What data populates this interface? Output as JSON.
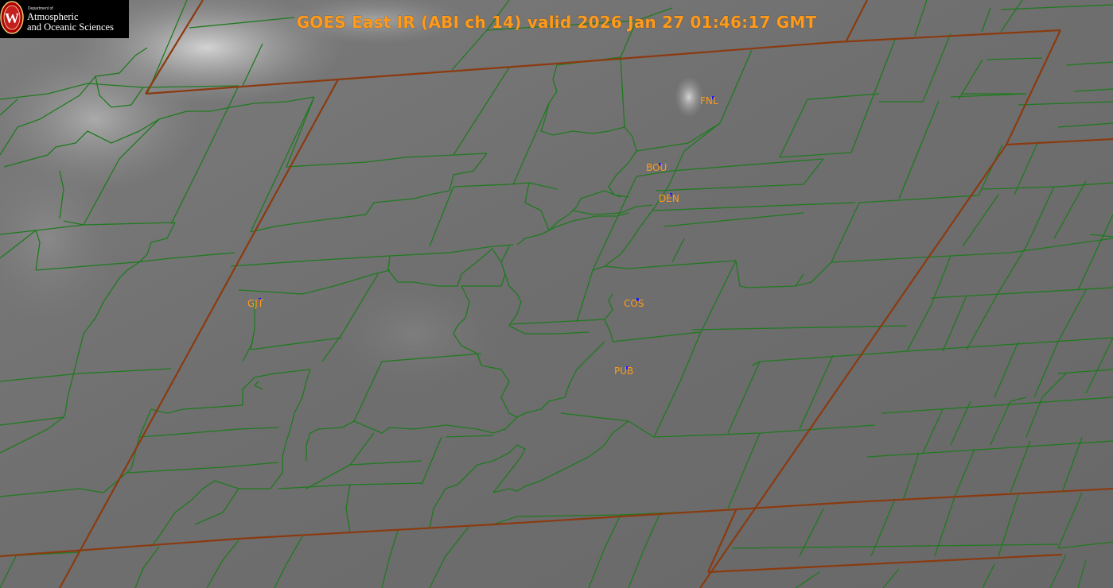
{
  "title": "GOES East IR (ABI ch 14) valid 2026 Jan 27 01:46:17 GMT",
  "logo": {
    "department": "Department of",
    "line1": "Atmospheric",
    "line2": "and Oceanic Sciences",
    "seal_letter": "W"
  },
  "stations": [
    {
      "code": "FNL"
    },
    {
      "code": "BOU"
    },
    {
      "code": "DEN"
    },
    {
      "code": "GJT"
    },
    {
      "code": "COS"
    },
    {
      "code": "PUB"
    }
  ],
  "colors": {
    "background": "#6a6a6a",
    "county_lines": "#1f7a1f",
    "state_lines": "#8b3a0f",
    "label_orange": "#ff9a1a",
    "station_marker": "#1a1aff"
  }
}
